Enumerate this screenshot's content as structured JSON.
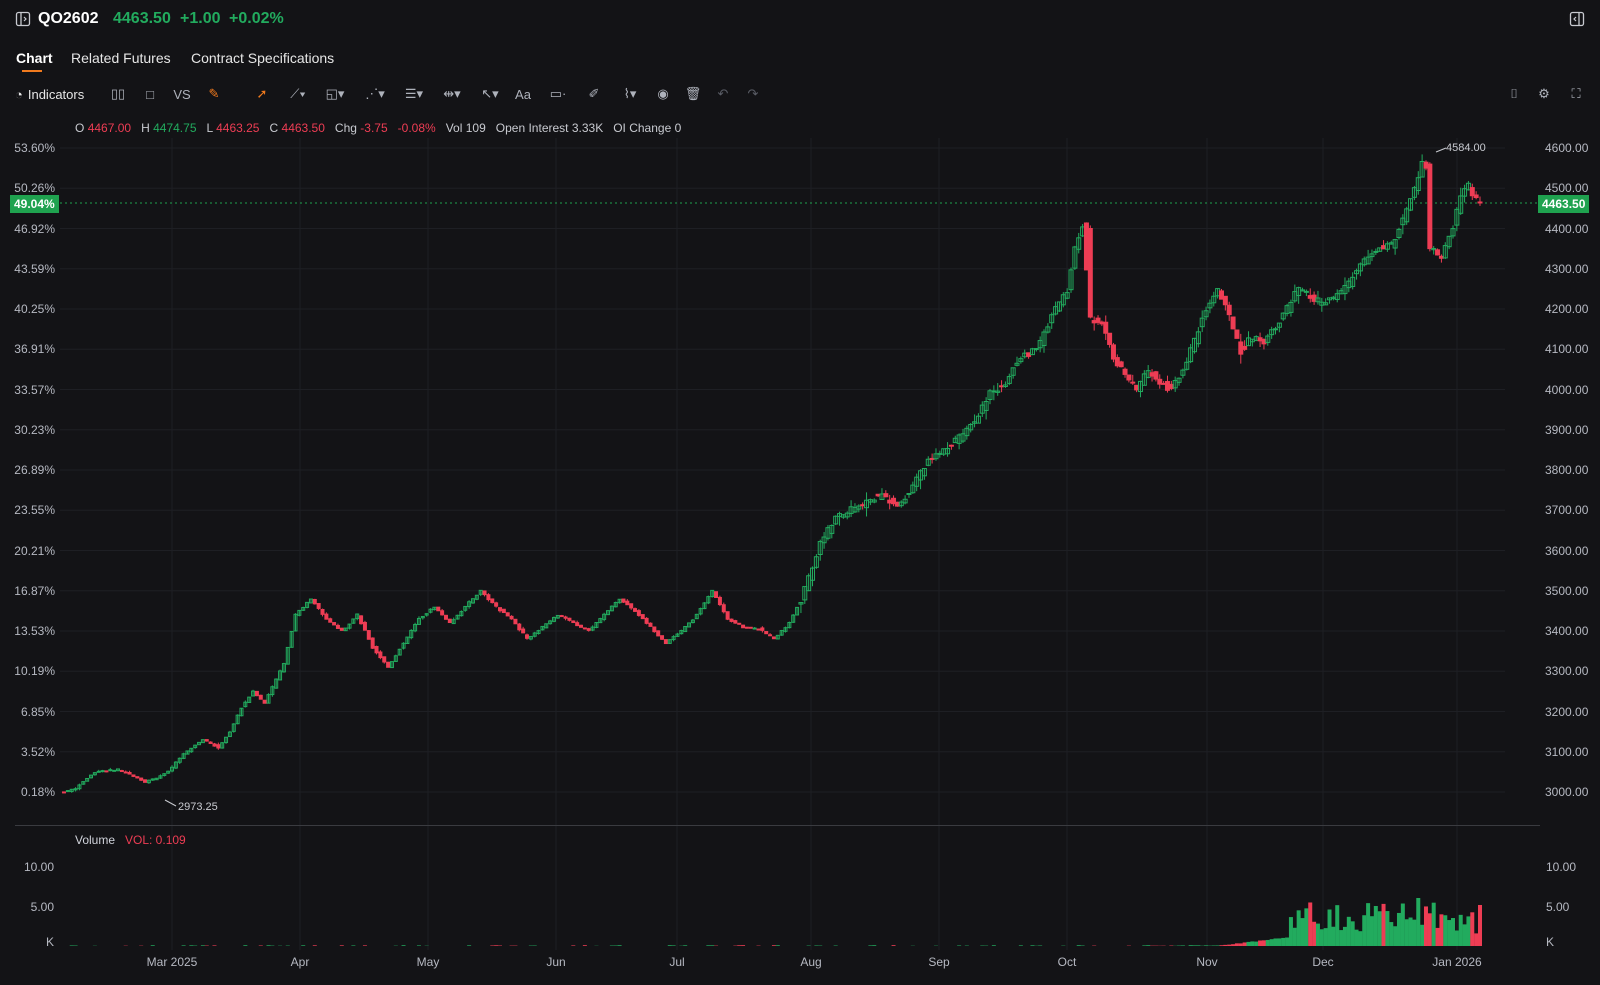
{
  "header": {
    "symbol": "QO2602",
    "price": "4463.50",
    "change": "+1.00",
    "change_pct": "+0.02%"
  },
  "tabs": [
    "Chart",
    "Related Futures",
    "Contract Specifications"
  ],
  "toolbar": {
    "indicators_label": "Indicators",
    "vs_label": "VS",
    "text_tool_label": "Aa"
  },
  "ohlc": {
    "o_label": "O",
    "o_val": "4467.00",
    "h_label": "H",
    "h_val": "4474.75",
    "l_label": "L",
    "l_val": "4463.25",
    "c_label": "C",
    "c_val": "4463.50",
    "chg_label": "Chg",
    "chg_val": "-3.75",
    "chg_pct": "-0.08%",
    "vol_label": "Vol",
    "vol_val": "109",
    "oi_label": "Open Interest",
    "oi_val": "3.33K",
    "oichg_label": "OI Change",
    "oichg_val": "0"
  },
  "current_pct_badge": "49.04%",
  "current_price_badge": "4463.50",
  "high_marker": "4584.00",
  "low_marker": "2973.25",
  "volume_pane": {
    "title": "Volume",
    "vol_label": "VOL: 0.109",
    "left_ticks": [
      "10.00",
      "5.00",
      "K"
    ],
    "right_ticks": [
      "10.00",
      "5.00",
      "K"
    ]
  },
  "colors": {
    "up": "#22ab5e",
    "down": "#ee3d54",
    "accent": "#f07a1e",
    "background": "#131316"
  },
  "chart_data": {
    "type": "candlestick",
    "y_left_ticks": [
      "53.60%",
      "50.26%",
      "46.92%",
      "43.59%",
      "40.25%",
      "36.91%",
      "33.57%",
      "30.23%",
      "26.89%",
      "23.55%",
      "20.21%",
      "16.87%",
      "13.53%",
      "10.19%",
      "6.85%",
      "3.52%",
      "0.18%"
    ],
    "y_right_ticks": [
      "4600.00",
      "4500.00",
      "4400.00",
      "4300.00",
      "4200.00",
      "4100.00",
      "4000.00",
      "3900.00",
      "3800.00",
      "3700.00",
      "3600.00",
      "3500.00",
      "3400.00",
      "3300.00",
      "3200.00",
      "3100.00",
      "3000.00"
    ],
    "x_ticks": [
      "Mar 2025",
      "Apr",
      "May",
      "Jun",
      "Jul",
      "Aug",
      "Sep",
      "Oct",
      "Nov",
      "Dec",
      "Jan 2026"
    ],
    "ylim": [
      2960,
      4620
    ],
    "price_path": [
      [
        0,
        3000
      ],
      [
        3,
        3010
      ],
      [
        8,
        3050
      ],
      [
        14,
        3055
      ],
      [
        18,
        3040
      ],
      [
        21,
        3025
      ],
      [
        24,
        3035
      ],
      [
        27,
        3050
      ],
      [
        31,
        3095
      ],
      [
        36,
        3130
      ],
      [
        40,
        3110
      ],
      [
        43,
        3150
      ],
      [
        46,
        3210
      ],
      [
        49,
        3250
      ],
      [
        52,
        3220
      ],
      [
        55,
        3280
      ],
      [
        57,
        3320
      ],
      [
        60,
        3440
      ],
      [
        64,
        3480
      ],
      [
        68,
        3430
      ],
      [
        72,
        3400
      ],
      [
        76,
        3440
      ],
      [
        80,
        3360
      ],
      [
        84,
        3310
      ],
      [
        88,
        3370
      ],
      [
        92,
        3430
      ],
      [
        96,
        3460
      ],
      [
        100,
        3420
      ],
      [
        104,
        3460
      ],
      [
        108,
        3500
      ],
      [
        112,
        3460
      ],
      [
        116,
        3430
      ],
      [
        120,
        3380
      ],
      [
        124,
        3410
      ],
      [
        128,
        3440
      ],
      [
        132,
        3420
      ],
      [
        136,
        3400
      ],
      [
        140,
        3440
      ],
      [
        144,
        3480
      ],
      [
        148,
        3450
      ],
      [
        152,
        3410
      ],
      [
        156,
        3370
      ],
      [
        160,
        3400
      ],
      [
        164,
        3440
      ],
      [
        168,
        3500
      ],
      [
        172,
        3430
      ],
      [
        176,
        3410
      ],
      [
        180,
        3405
      ],
      [
        184,
        3380
      ],
      [
        188,
        3420
      ],
      [
        192,
        3500
      ],
      [
        196,
        3620
      ],
      [
        200,
        3680
      ],
      [
        204,
        3700
      ],
      [
        208,
        3720
      ],
      [
        212,
        3740
      ],
      [
        216,
        3710
      ],
      [
        220,
        3760
      ],
      [
        224,
        3820
      ],
      [
        228,
        3850
      ],
      [
        232,
        3880
      ],
      [
        236,
        3920
      ],
      [
        240,
        3990
      ],
      [
        244,
        4020
      ],
      [
        248,
        4080
      ],
      [
        252,
        4100
      ],
      [
        256,
        4180
      ],
      [
        260,
        4250
      ],
      [
        262,
        4350
      ],
      [
        264,
        4410
      ],
      [
        266,
        4180
      ],
      [
        269,
        4160
      ],
      [
        272,
        4080
      ],
      [
        275,
        4040
      ],
      [
        278,
        4000
      ],
      [
        281,
        4050
      ],
      [
        284,
        4020
      ],
      [
        287,
        4000
      ],
      [
        290,
        4050
      ],
      [
        293,
        4120
      ],
      [
        296,
        4200
      ],
      [
        299,
        4250
      ],
      [
        302,
        4180
      ],
      [
        305,
        4100
      ],
      [
        308,
        4130
      ],
      [
        311,
        4120
      ],
      [
        314,
        4160
      ],
      [
        317,
        4200
      ],
      [
        320,
        4250
      ],
      [
        323,
        4230
      ],
      [
        326,
        4210
      ],
      [
        329,
        4230
      ],
      [
        332,
        4250
      ],
      [
        335,
        4300
      ],
      [
        338,
        4330
      ],
      [
        341,
        4350
      ],
      [
        344,
        4360
      ],
      [
        347,
        4420
      ],
      [
        350,
        4500
      ],
      [
        352,
        4560
      ],
      [
        353,
        4550
      ],
      [
        354,
        4350
      ],
      [
        357,
        4330
      ],
      [
        360,
        4400
      ],
      [
        362,
        4480
      ],
      [
        364,
        4510
      ],
      [
        366,
        4470
      ],
      [
        367,
        4463.5
      ]
    ],
    "volume_bars": "sparse near zero until mid-Nov 2025, then rising to ~10-12K in late Dec 2025"
  }
}
